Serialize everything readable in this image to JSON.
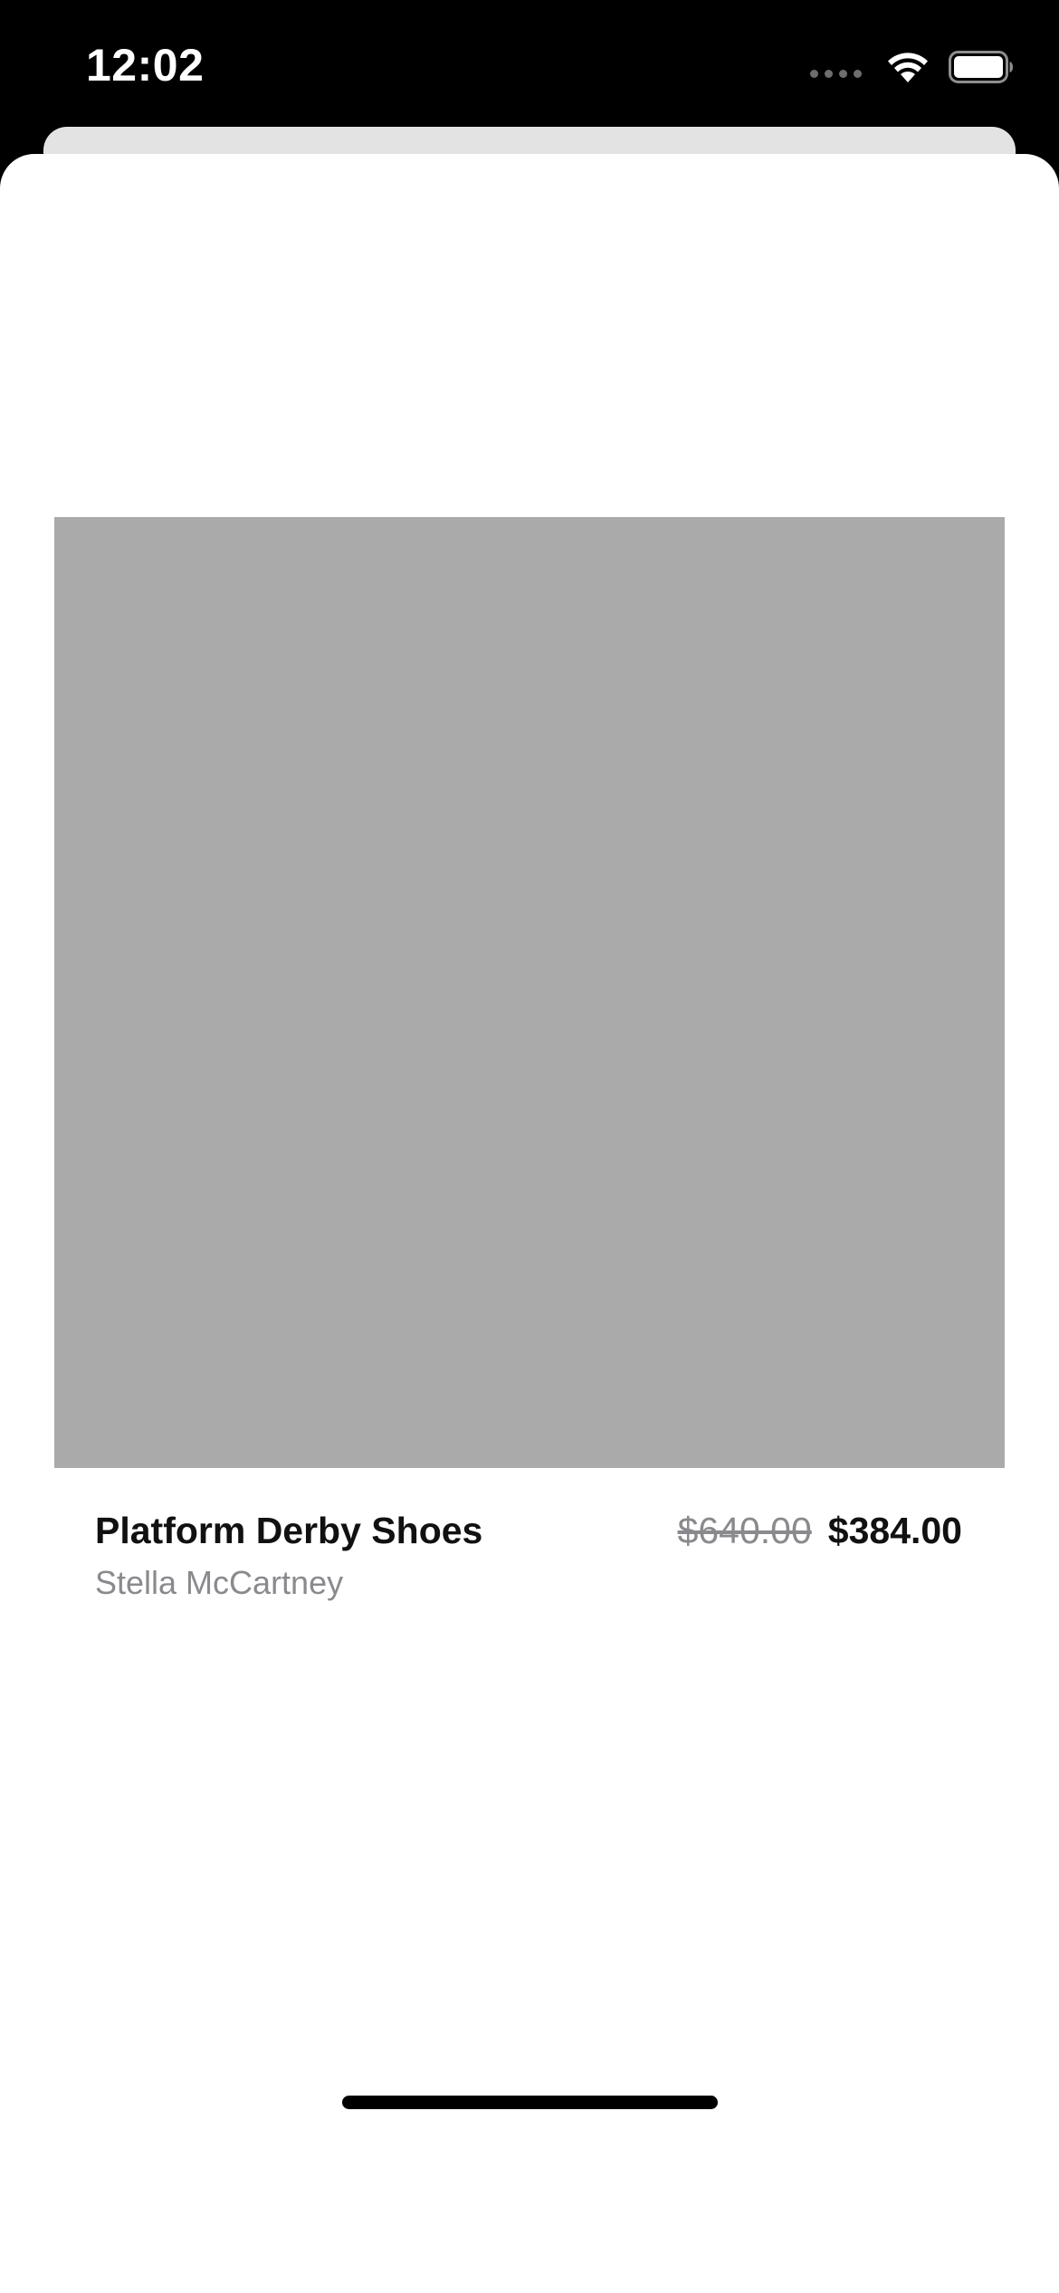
{
  "status_bar": {
    "time": "12:02",
    "signal_icon": "cellular-signal-icon",
    "wifi_icon": "wifi-icon",
    "battery_icon": "battery-icon"
  },
  "product": {
    "name": "Platform Derby Shoes",
    "brand": "Stella McCartney",
    "original_price": "$640.00",
    "sale_price": "$384.00"
  },
  "colors": {
    "status_bar_background": "#000000",
    "sheet_background": "#ffffff",
    "image_placeholder": "#aaaaaa",
    "secondary_text": "#8a8a8e",
    "primary_text": "#111111"
  }
}
